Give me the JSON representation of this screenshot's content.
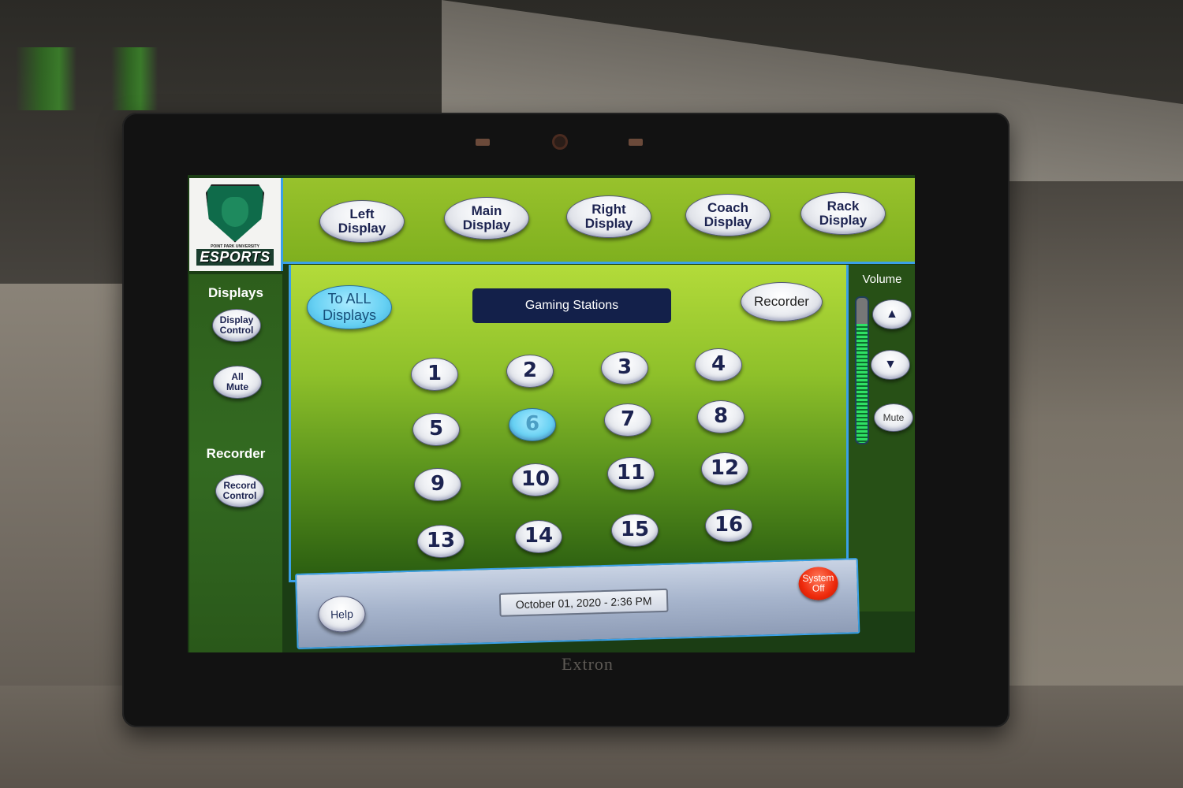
{
  "device": {
    "brand": "Extron"
  },
  "logo": {
    "subtitle": "POINT PARK UNIVERSITY",
    "title": "ESPORTS"
  },
  "topbar": {
    "buttons": [
      {
        "id": "left-display",
        "line1": "Left",
        "line2": "Display"
      },
      {
        "id": "main-display",
        "line1": "Main",
        "line2": "Display"
      },
      {
        "id": "right-display",
        "line1": "Right",
        "line2": "Display"
      },
      {
        "id": "coach-display",
        "line1": "Coach",
        "line2": "Display"
      },
      {
        "id": "rack-display",
        "line1": "Rack",
        "line2": "Display"
      }
    ]
  },
  "sidebar": {
    "displays_heading": "Displays",
    "display_control": {
      "line1": "Display",
      "line2": "Control"
    },
    "all_mute": {
      "line1": "All",
      "line2": "Mute"
    },
    "recorder_heading": "Recorder",
    "record_control": {
      "line1": "Record",
      "line2": "Control"
    }
  },
  "main": {
    "to_all": {
      "line1": "To ALL",
      "line2": "Displays"
    },
    "title": "Gaming Stations",
    "recorder_button": "Recorder",
    "stations": [
      "1",
      "2",
      "3",
      "4",
      "5",
      "6",
      "7",
      "8",
      "9",
      "10",
      "11",
      "12",
      "13",
      "14",
      "15",
      "16"
    ],
    "active_station": "6"
  },
  "volume": {
    "label": "Volume",
    "level_percent": 82,
    "up_icon": "triangle-up-icon",
    "down_icon": "triangle-down-icon",
    "mute_label": "Mute"
  },
  "bottombar": {
    "help_label": "Help",
    "datetime": "October 01, 2020  -  2:36 PM",
    "system_off": {
      "line1": "System",
      "line2": "Off"
    }
  },
  "colors": {
    "accent_blue": "#3aa0e8",
    "active_cyan": "#66d0f3",
    "title_navy": "#13204a",
    "system_off_red": "#ee2a0c",
    "topbar_green": "#8dbb26",
    "sidebar_green": "#2d5e1c"
  }
}
